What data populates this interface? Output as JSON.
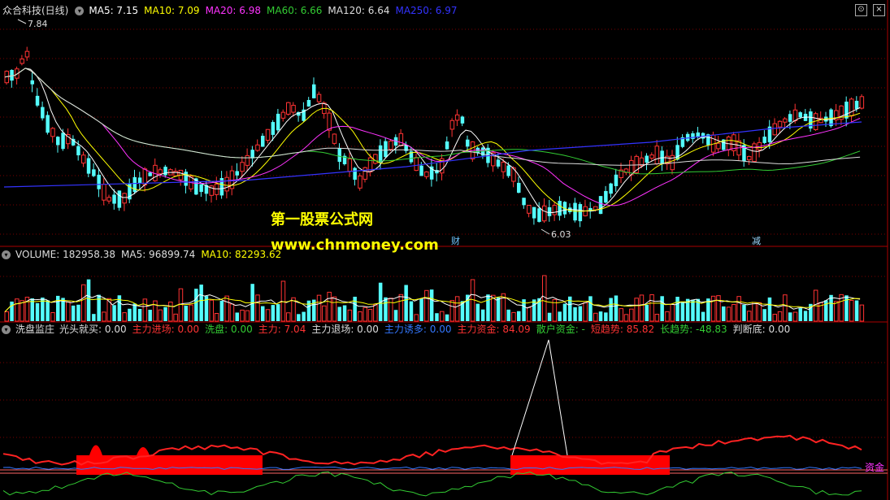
{
  "title": "众合科技(日线)",
  "price_panel": {
    "ma": [
      {
        "label": "MA5: 7.15",
        "color": "#ffffff"
      },
      {
        "label": "MA10: 7.09",
        "color": "#ffff00"
      },
      {
        "label": "MA20: 6.98",
        "color": "#ff33ff"
      },
      {
        "label": "MA60: 6.66",
        "color": "#33cc33"
      },
      {
        "label": "MA120: 6.64",
        "color": "#dddddd"
      },
      {
        "label": "MA250: 6.97",
        "color": "#3333ff"
      }
    ],
    "high_label": "7.84",
    "low_label": "6.03",
    "tag_cai": "财",
    "tag_jian": "减"
  },
  "watermark": {
    "line1": "第一股票公式网",
    "line2": "www.chnmoney.com"
  },
  "volume_panel": {
    "items": [
      {
        "label": "VOLUME: 182958.38",
        "color": "#dddddd"
      },
      {
        "label": "MA5: 96899.74",
        "color": "#dddddd"
      },
      {
        "label": "MA10: 82293.62",
        "color": "#ffff00"
      }
    ]
  },
  "indicator_panel": {
    "name": "洗盘监庄",
    "items": [
      {
        "label": "光头就买: 0.00",
        "color": "#dddddd"
      },
      {
        "label": "主力进场: 0.00",
        "color": "#ff3333"
      },
      {
        "label": "洗盘: 0.00",
        "color": "#33cc33"
      },
      {
        "label": "主力: 7.04",
        "color": "#ff3333"
      },
      {
        "label": "主力退场: 0.00",
        "color": "#dddddd"
      },
      {
        "label": "主力诱多: 0.00",
        "color": "#3377ff"
      },
      {
        "label": "主力资金: 84.09",
        "color": "#ff3333"
      },
      {
        "label": "散户资金: -",
        "color": "#33cc33"
      },
      {
        "label": "短趋势: 85.82",
        "color": "#ff3333"
      },
      {
        "label": "长趋势: -48.83",
        "color": "#33cc33"
      },
      {
        "label": "判断底: 0.00",
        "color": "#dddddd"
      }
    ],
    "right_tag": "资金"
  },
  "colors": {
    "up": "#ff3333",
    "down": "#54fcfc",
    "grid": "#7a0000",
    "separator": "#aa0000"
  }
}
